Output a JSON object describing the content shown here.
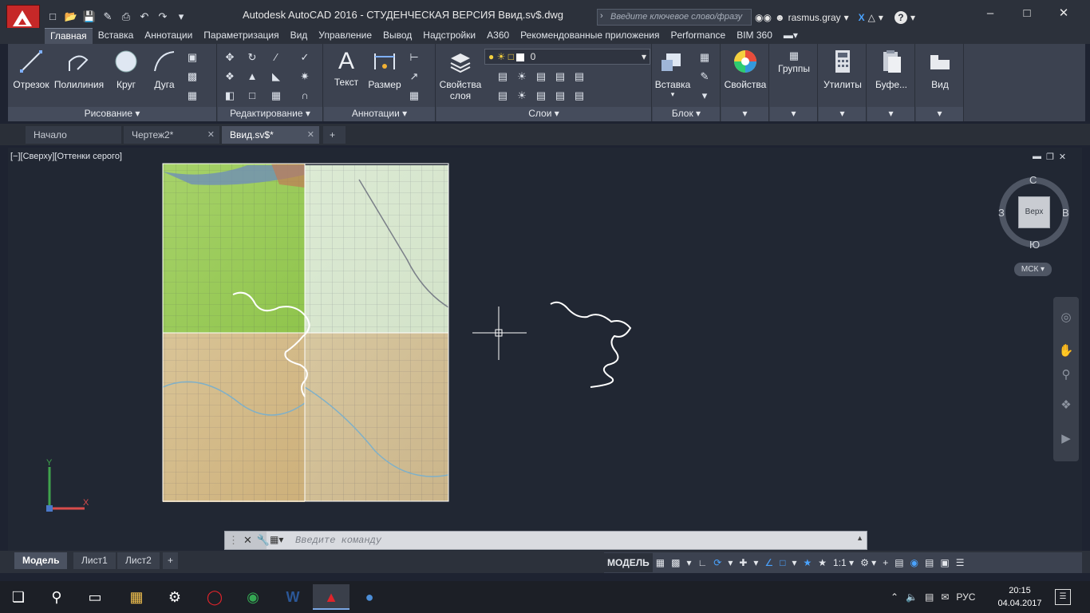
{
  "window": {
    "title": "Autodesk AutoCAD 2016 - СТУДЕНЧЕСКАЯ ВЕРСИЯ    Ввид.sv$.dwg",
    "search_placeholder": "Введите ключевое слово/фразу",
    "user": "rasmus.gray"
  },
  "ribbon_tabs": [
    "Главная",
    "Вставка",
    "Аннотации",
    "Параметризация",
    "Вид",
    "Управление",
    "Вывод",
    "Надстройки",
    "A360",
    "Рекомендованные приложения",
    "Performance",
    "BIM 360"
  ],
  "ribbon": {
    "draw": {
      "title": "Рисование",
      "line": "Отрезок",
      "polyline": "Полилиния",
      "circle": "Круг",
      "arc": "Дуга"
    },
    "modify": {
      "title": "Редактирование"
    },
    "annotation": {
      "title": "Аннотации",
      "text": "Текст",
      "dimension": "Размер"
    },
    "layers": {
      "title": "Слои",
      "properties_line1": "Свойства",
      "properties_line2": "слоя",
      "current_layer": "0"
    },
    "block": {
      "title": "Блок",
      "insert": "Вставка"
    },
    "properties": {
      "label": "Свойства"
    },
    "groups": {
      "label": "Группы"
    },
    "utilities": {
      "label": "Утилиты"
    },
    "clipboard": {
      "label": "Буфе..."
    },
    "view": {
      "label": "Вид"
    }
  },
  "doc_tabs": [
    {
      "label": "Начало"
    },
    {
      "label": "Чертеж2*"
    },
    {
      "label": "Ввид.sv$*"
    }
  ],
  "viewport": {
    "label": "[−][Сверху][Оттенки серого]",
    "navcube": {
      "face": "Верх",
      "north": "С",
      "south": "Ю",
      "west": "З",
      "east": "В"
    },
    "wcs": "МСК"
  },
  "command_line": {
    "placeholder": "Введите команду"
  },
  "layout_tabs": [
    "Модель",
    "Лист1",
    "Лист2"
  ],
  "status": {
    "model": "МОДЕЛЬ",
    "scale": "1:1"
  },
  "taskbar": {
    "language": "РУС",
    "time": "20:15",
    "date": "04.04.2017"
  },
  "colors": {
    "autocad_red": "#c62828",
    "active_blue": "#4aa3ff"
  }
}
